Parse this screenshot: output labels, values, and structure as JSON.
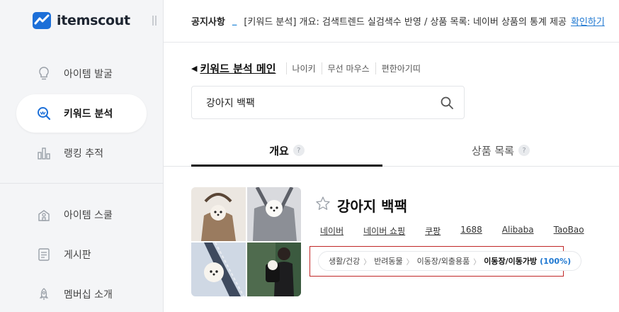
{
  "brand": {
    "name": "itemscout",
    "color": "#1c6fd8"
  },
  "sidebar": {
    "items": [
      {
        "label": "아이템 발굴",
        "icon": "lightbulb-icon"
      },
      {
        "label": "키워드 분석",
        "icon": "keyword-search-icon",
        "active": true
      },
      {
        "label": "랭킹 추적",
        "icon": "bar-chart-icon"
      },
      {
        "label": "아이템 스쿨",
        "icon": "school-icon"
      },
      {
        "label": "게시판",
        "icon": "board-icon"
      },
      {
        "label": "멤버십 소개",
        "icon": "rocket-icon"
      }
    ]
  },
  "notice": {
    "title": "공지사항",
    "separator": "_",
    "text": "[키워드 분석] 개요: 검색트렌드 실검색수 반영 / 상품 목록: 네이버 상품의 통계 제공",
    "link": "확인하기"
  },
  "keyword_header": {
    "main": "키워드 분석 메인",
    "recent": [
      "나이키",
      "무선 마우스",
      "편한아기띠"
    ]
  },
  "search": {
    "value": "강아지 백팩",
    "placeholder": ""
  },
  "tabs": [
    {
      "label": "개요",
      "help": "?",
      "active": true
    },
    {
      "label": "상품 목록",
      "help": "?"
    }
  ],
  "product": {
    "title": "강아지 백팩",
    "shops": [
      "네이버",
      "네이버 쇼핑",
      "쿠팡",
      "1688",
      "Alibaba",
      "TaoBao"
    ],
    "category_path": [
      "생활/건강",
      "반려동물",
      "이동장/외출용품"
    ],
    "category_last": "이동장/이동가방",
    "category_pct": "(100%)"
  },
  "colors": {
    "accent": "#1f78d1",
    "highlight_border": "#c02828",
    "sidebar_bg": "#f4f5f7"
  }
}
